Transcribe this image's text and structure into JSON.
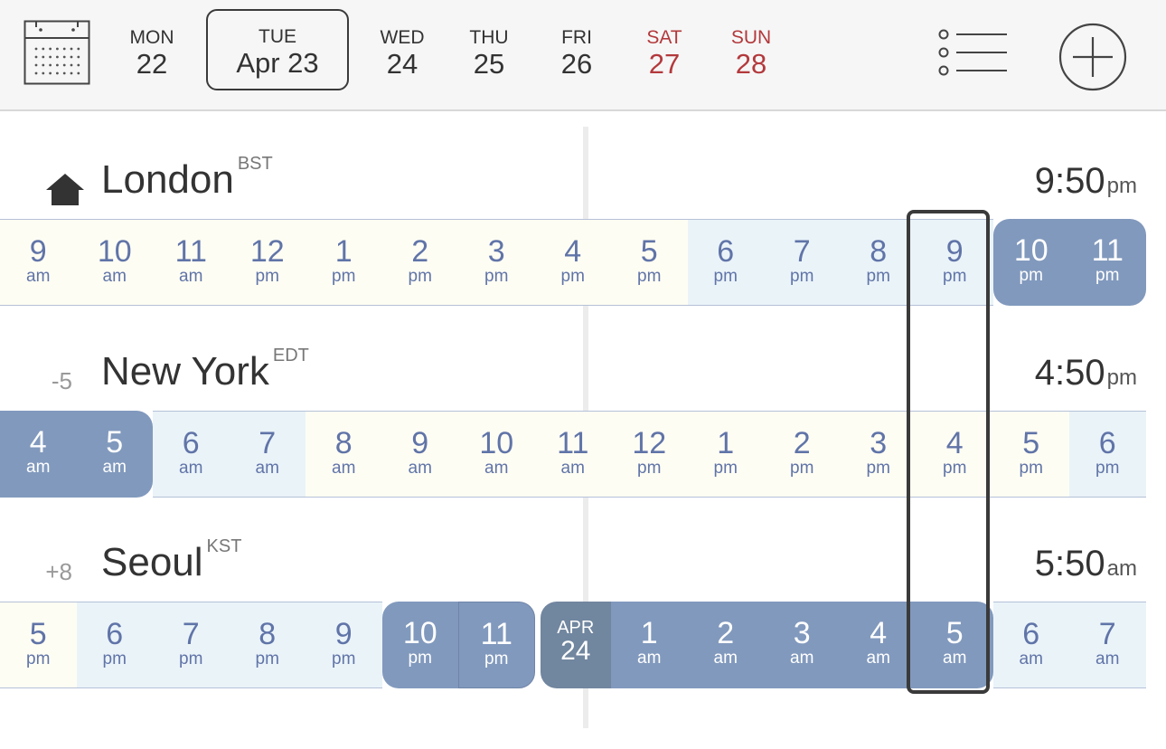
{
  "header": {
    "days": [
      {
        "dow": "MON",
        "num": "22",
        "type": "weekday"
      },
      {
        "dow": "TUE",
        "num": "Apr 23",
        "type": "selected"
      },
      {
        "dow": "WED",
        "num": "24",
        "type": "weekday"
      },
      {
        "dow": "THU",
        "num": "25",
        "type": "weekday"
      },
      {
        "dow": "FRI",
        "num": "26",
        "type": "weekday"
      },
      {
        "dow": "SAT",
        "num": "27",
        "type": "weekend"
      },
      {
        "dow": "SUN",
        "num": "28",
        "type": "weekend"
      }
    ],
    "icons": {
      "calendar": "calendar-icon",
      "list": "list-icon",
      "add": "add-circle-icon"
    }
  },
  "cities": [
    {
      "name": "London",
      "abbr": "BST",
      "offset": "",
      "home": true,
      "time": "9:50",
      "ampm": "pm",
      "hours": [
        {
          "h": "9",
          "ap": "am",
          "t": "day"
        },
        {
          "h": "10",
          "ap": "am",
          "t": "day"
        },
        {
          "h": "11",
          "ap": "am",
          "t": "day"
        },
        {
          "h": "12",
          "ap": "pm",
          "t": "day"
        },
        {
          "h": "1",
          "ap": "pm",
          "t": "day"
        },
        {
          "h": "2",
          "ap": "pm",
          "t": "day"
        },
        {
          "h": "3",
          "ap": "pm",
          "t": "day"
        },
        {
          "h": "4",
          "ap": "pm",
          "t": "day"
        },
        {
          "h": "5",
          "ap": "pm",
          "t": "day"
        },
        {
          "h": "6",
          "ap": "pm",
          "t": "eve"
        },
        {
          "h": "7",
          "ap": "pm",
          "t": "eve"
        },
        {
          "h": "8",
          "ap": "pm",
          "t": "eve"
        },
        {
          "h": "9",
          "ap": "pm",
          "t": "eve"
        },
        {
          "h": "10",
          "ap": "pm",
          "t": "night"
        },
        {
          "h": "11",
          "ap": "pm",
          "t": "night"
        }
      ]
    },
    {
      "name": "New York",
      "abbr": "EDT",
      "offset": "-5",
      "home": false,
      "time": "4:50",
      "ampm": "pm",
      "hours": [
        {
          "h": "4",
          "ap": "am",
          "t": "night"
        },
        {
          "h": "5",
          "ap": "am",
          "t": "night"
        },
        {
          "h": "6",
          "ap": "am",
          "t": "eve"
        },
        {
          "h": "7",
          "ap": "am",
          "t": "eve"
        },
        {
          "h": "8",
          "ap": "am",
          "t": "day"
        },
        {
          "h": "9",
          "ap": "am",
          "t": "day"
        },
        {
          "h": "10",
          "ap": "am",
          "t": "day"
        },
        {
          "h": "11",
          "ap": "am",
          "t": "day"
        },
        {
          "h": "12",
          "ap": "pm",
          "t": "day"
        },
        {
          "h": "1",
          "ap": "pm",
          "t": "day"
        },
        {
          "h": "2",
          "ap": "pm",
          "t": "day"
        },
        {
          "h": "3",
          "ap": "pm",
          "t": "day"
        },
        {
          "h": "4",
          "ap": "pm",
          "t": "day"
        },
        {
          "h": "5",
          "ap": "pm",
          "t": "day"
        },
        {
          "h": "6",
          "ap": "pm",
          "t": "eve"
        }
      ]
    },
    {
      "name": "Seoul",
      "abbr": "KST",
      "offset": "+8",
      "home": false,
      "time": "5:50",
      "ampm": "am",
      "hours": [
        {
          "h": "5",
          "ap": "pm",
          "t": "day"
        },
        {
          "h": "6",
          "ap": "pm",
          "t": "eve"
        },
        {
          "h": "7",
          "ap": "pm",
          "t": "eve"
        },
        {
          "h": "8",
          "ap": "pm",
          "t": "eve"
        },
        {
          "h": "9",
          "ap": "pm",
          "t": "eve"
        },
        {
          "h": "10",
          "ap": "pm",
          "t": "night"
        },
        {
          "h": "11",
          "ap": "pm",
          "t": "night"
        },
        {
          "h": "APR",
          "ap": "24",
          "t": "date"
        },
        {
          "h": "1",
          "ap": "am",
          "t": "night"
        },
        {
          "h": "2",
          "ap": "am",
          "t": "night"
        },
        {
          "h": "3",
          "ap": "am",
          "t": "night"
        },
        {
          "h": "4",
          "ap": "am",
          "t": "night"
        },
        {
          "h": "5",
          "ap": "am",
          "t": "night"
        },
        {
          "h": "6",
          "ap": "am",
          "t": "eve"
        },
        {
          "h": "7",
          "ap": "am",
          "t": "eve"
        }
      ]
    }
  ],
  "colors": {
    "weekend": "#b3393c",
    "day": "#fefdf3",
    "evening": "#eaf3f8",
    "night": "#8199bd",
    "hourText": "#6074a8"
  }
}
